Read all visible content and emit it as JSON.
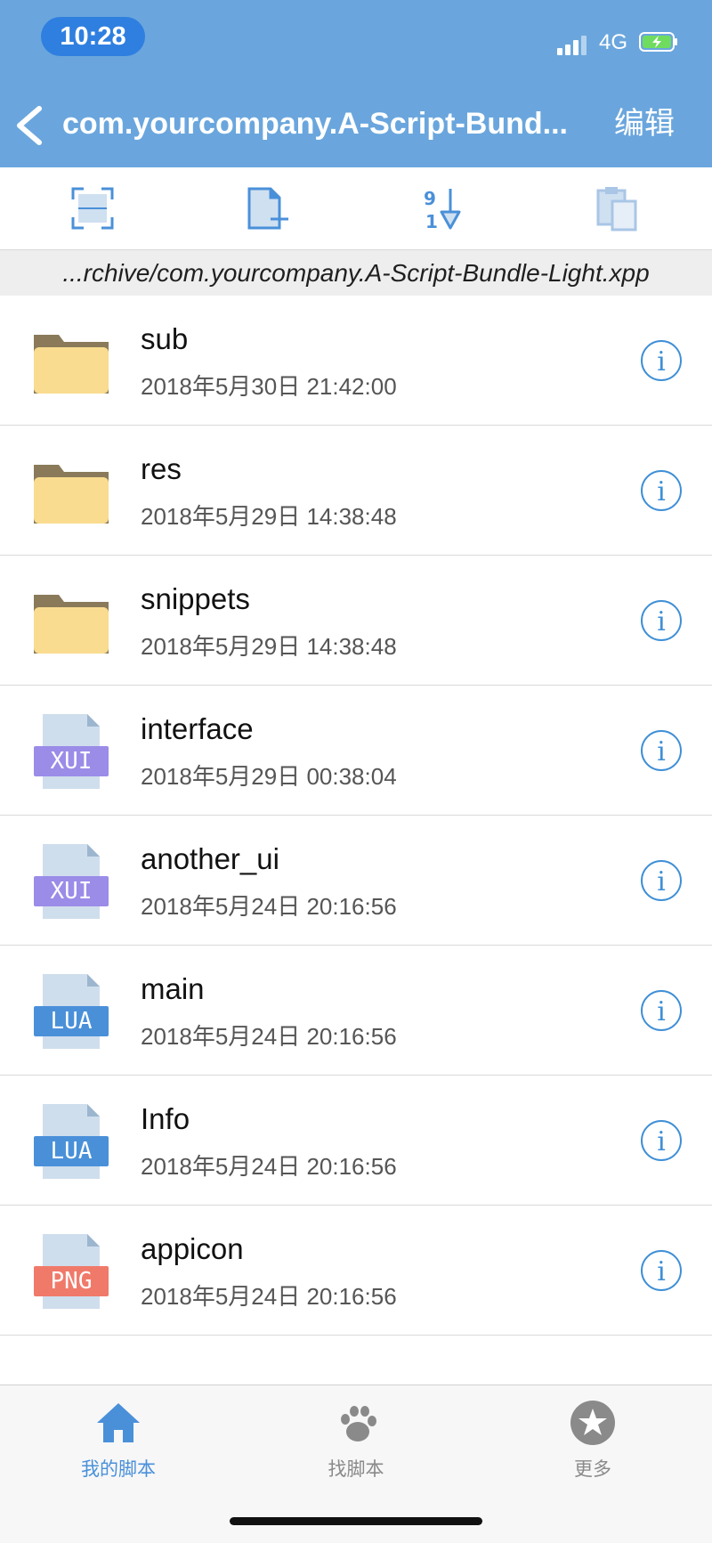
{
  "status_bar": {
    "time": "10:28",
    "network": "4G"
  },
  "nav": {
    "title": "com.yourcompany.A-Script-Bund...",
    "edit_label": "编辑"
  },
  "toolbar": {
    "icons": [
      "scan-icon",
      "new-file-icon",
      "sort-icon",
      "paste-icon"
    ]
  },
  "path_bar": {
    "text": "...rchive/com.yourcompany.A-Script-Bundle-Light.xpp"
  },
  "files": [
    {
      "name": "sub",
      "date": "2018年5月30日 21:42:00",
      "type": "folder"
    },
    {
      "name": "res",
      "date": "2018年5月29日 14:38:48",
      "type": "folder"
    },
    {
      "name": "snippets",
      "date": "2018年5月29日 14:38:48",
      "type": "folder"
    },
    {
      "name": "interface",
      "date": "2018年5月29日 00:38:04",
      "type": "xui",
      "badge": "XUI"
    },
    {
      "name": "another_ui",
      "date": "2018年5月24日 20:16:56",
      "type": "xui",
      "badge": "XUI"
    },
    {
      "name": "main",
      "date": "2018年5月24日 20:16:56",
      "type": "lua",
      "badge": "LUA"
    },
    {
      "name": "Info",
      "date": "2018年5月24日 20:16:56",
      "type": "lua",
      "badge": "LUA"
    },
    {
      "name": "appicon",
      "date": "2018年5月24日 20:16:56",
      "type": "png",
      "badge": "PNG"
    }
  ],
  "tabbar": {
    "items": [
      {
        "label": "我的脚本",
        "icon": "home-icon",
        "active": true
      },
      {
        "label": "找脚本",
        "icon": "paw-icon",
        "active": false
      },
      {
        "label": "更多",
        "icon": "star-icon",
        "active": false
      }
    ]
  },
  "colors": {
    "nav_bg": "#6aa6dd",
    "accent": "#3f8fd6",
    "folder": "#f9dc8f",
    "xui": "#9b8ce8",
    "lua": "#4a90d9",
    "png": "#f07a6a"
  }
}
